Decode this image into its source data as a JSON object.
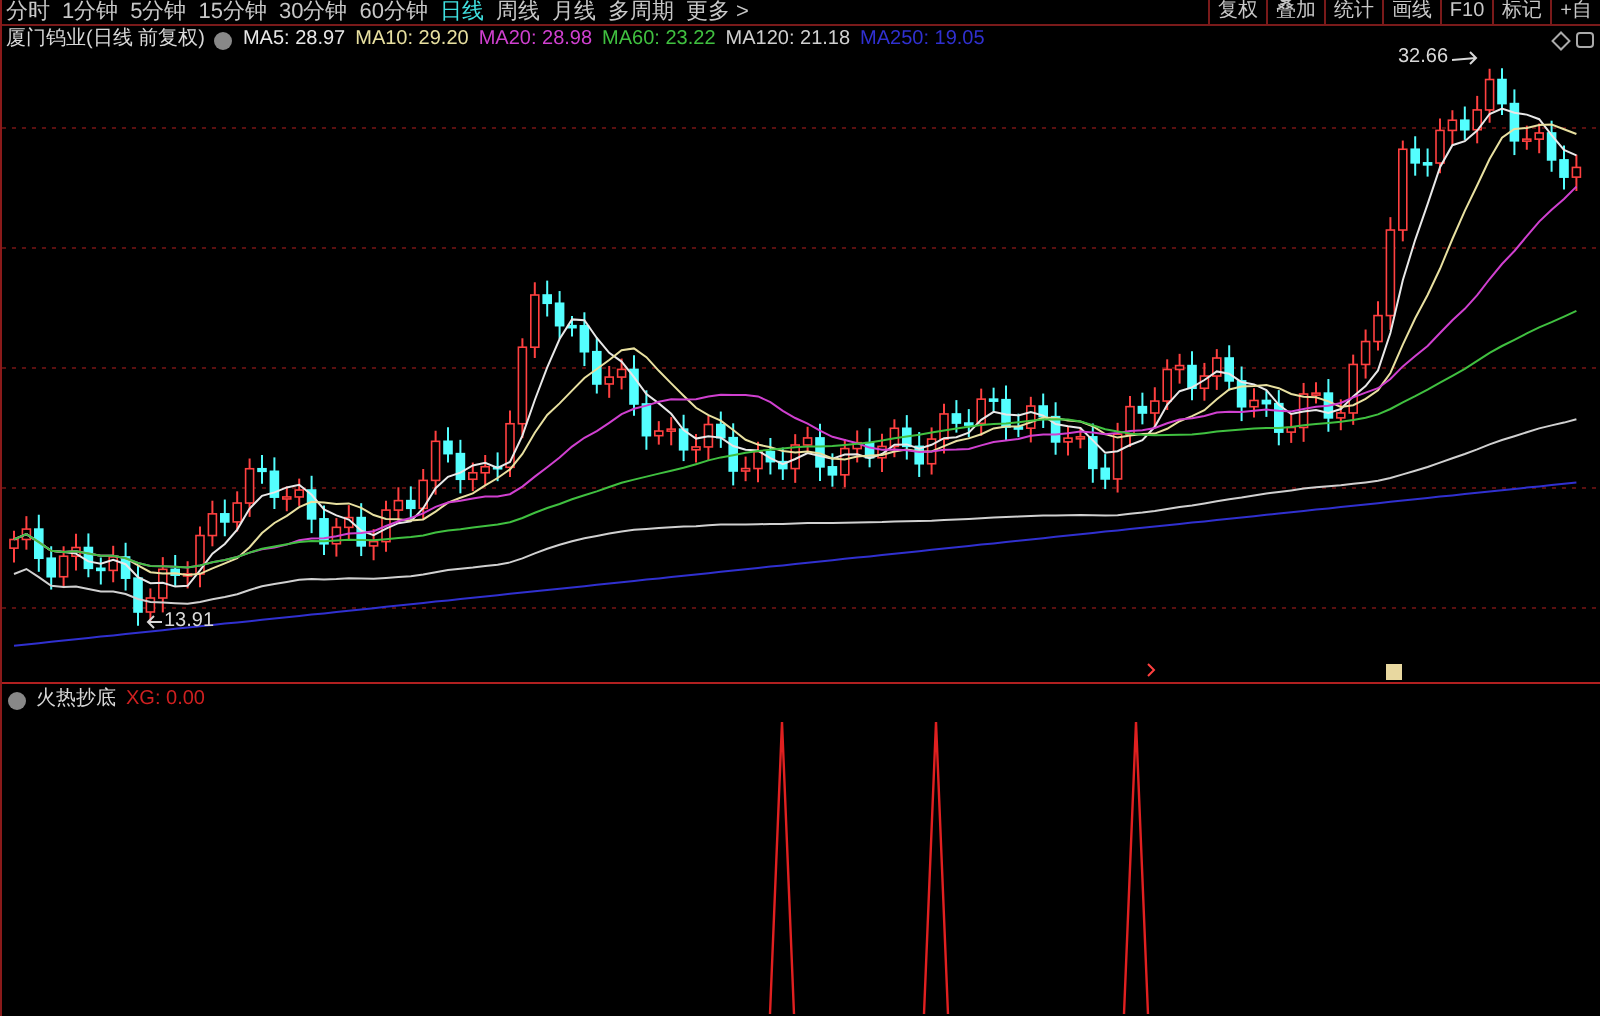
{
  "periods": [
    {
      "label": "分时",
      "selected": false
    },
    {
      "label": "1分钟",
      "selected": false
    },
    {
      "label": "5分钟",
      "selected": false
    },
    {
      "label": "15分钟",
      "selected": false
    },
    {
      "label": "30分钟",
      "selected": false
    },
    {
      "label": "60分钟",
      "selected": false
    },
    {
      "label": "日线",
      "selected": true
    },
    {
      "label": "周线",
      "selected": false
    },
    {
      "label": "月线",
      "selected": false
    },
    {
      "label": "多周期",
      "selected": false
    },
    {
      "label": "更多 >",
      "selected": false
    }
  ],
  "tools": [
    "复权",
    "叠加",
    "统计",
    "画线",
    "F10",
    "标记",
    "+自"
  ],
  "chart": {
    "title": "厦门钨业(日线 前复权)",
    "ma": [
      {
        "label": "MA5: 28.97",
        "color": "#e8e8e8"
      },
      {
        "label": "MA10: 29.20",
        "color": "#e8e0a0"
      },
      {
        "label": "MA20: 28.98",
        "color": "#d040d0"
      },
      {
        "label": "MA60: 23.22",
        "color": "#40c040"
      },
      {
        "label": "MA120: 21.18",
        "color": "#d0d0d0"
      },
      {
        "label": "MA250: 19.05",
        "color": "#3030d0"
      }
    ],
    "high_label": "32.66",
    "low_label": "13.91"
  },
  "indicator": {
    "name": "火热抄底",
    "value": "XG: 0.00"
  }
}
